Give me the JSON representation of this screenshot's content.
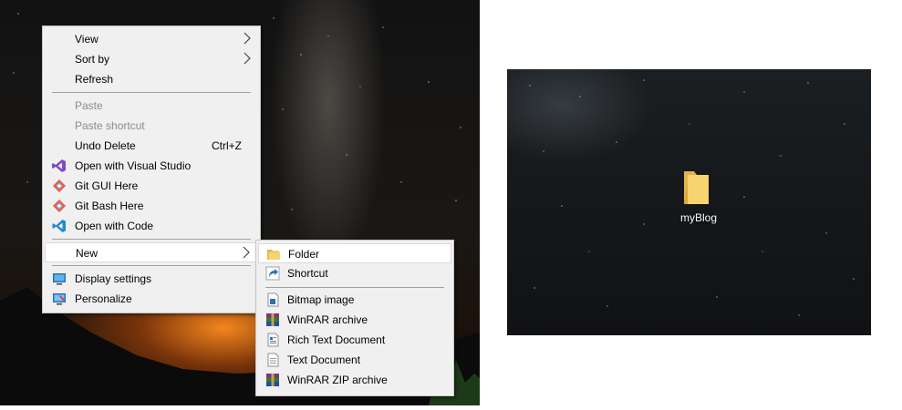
{
  "context_menu": {
    "items": [
      {
        "label": "View",
        "submenu": true
      },
      {
        "label": "Sort by",
        "submenu": true
      },
      {
        "label": "Refresh"
      },
      {
        "label": "Paste",
        "disabled": true
      },
      {
        "label": "Paste shortcut",
        "disabled": true
      },
      {
        "label": "Undo Delete",
        "shortcut": "Ctrl+Z"
      },
      {
        "label": "Open with Visual Studio",
        "icon": "visual-studio-icon"
      },
      {
        "label": "Git GUI Here",
        "icon": "git-icon"
      },
      {
        "label": "Git Bash Here",
        "icon": "git-icon"
      },
      {
        "label": "Open with Code",
        "icon": "vscode-icon"
      },
      {
        "label": "New",
        "submenu": true,
        "highlighted": true
      },
      {
        "label": "Display settings",
        "icon": "display-icon"
      },
      {
        "label": "Personalize",
        "icon": "personalize-icon"
      }
    ]
  },
  "new_submenu": {
    "items": [
      {
        "label": "Folder",
        "icon": "folder-icon",
        "highlighted": true
      },
      {
        "label": "Shortcut",
        "icon": "shortcut-icon"
      },
      {
        "label": "Bitmap image",
        "icon": "bitmap-icon"
      },
      {
        "label": "WinRAR archive",
        "icon": "winrar-icon"
      },
      {
        "label": "Rich Text Document",
        "icon": "rtf-icon"
      },
      {
        "label": "Text Document",
        "icon": "text-document-icon"
      },
      {
        "label": "WinRAR ZIP archive",
        "icon": "winrar-zip-icon"
      }
    ]
  },
  "desktop": {
    "folder_label": "myBlog"
  },
  "colors": {
    "menu_bg": "#f0f0f0",
    "highlight": "#ffffff",
    "disabled_text": "#8c8c8c"
  }
}
